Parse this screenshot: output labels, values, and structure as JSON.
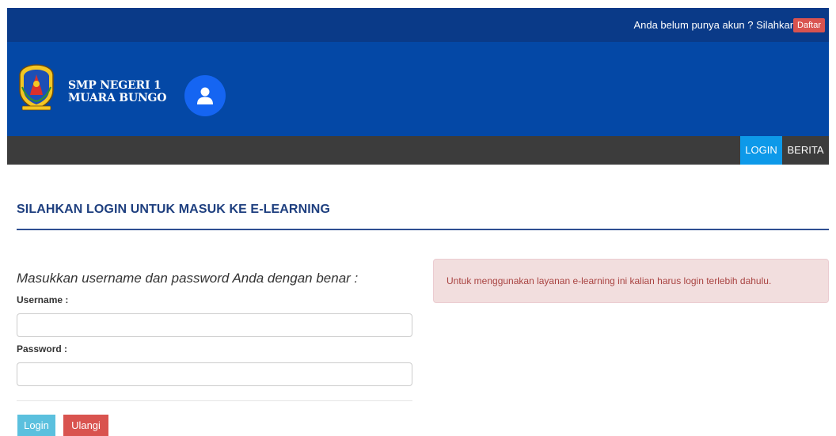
{
  "topbar": {
    "signup_prompt": "Anda belum punya akun ? Silahkan",
    "signup_button": "Daftar"
  },
  "header": {
    "school_line1": "SMP NEGERI 1",
    "school_line2": "MUARA BUNGO",
    "logo_icon": "school-crest-icon",
    "avatar_icon": "user-icon"
  },
  "nav": {
    "items": [
      {
        "label": "LOGIN",
        "active": true
      },
      {
        "label": "BERITA",
        "active": false
      }
    ]
  },
  "main": {
    "title": "SILAHKAN LOGIN UNTUK MASUK KE E-LEARNING",
    "instruction": "Masukkan username dan password Anda dengan benar :",
    "username_label": "Username :",
    "username_value": "",
    "password_label": "Password :",
    "password_value": "",
    "login_button": "Login",
    "reset_button": "Ulangi",
    "alert_text": "Untuk menggunakan layanan e-learning ini kalian harus login terlebih dahulu."
  },
  "colors": {
    "topbar_bg": "#0a3a88",
    "header_bg": "#0448a6",
    "navbar_bg": "#3c3c3c",
    "nav_active_bg": "#0d99e9",
    "title_color": "#1e3f7f",
    "login_button_bg": "#5bc0de",
    "reset_button_bg": "#d9534f",
    "alert_bg": "#f2dede",
    "alert_text": "#a94442"
  }
}
